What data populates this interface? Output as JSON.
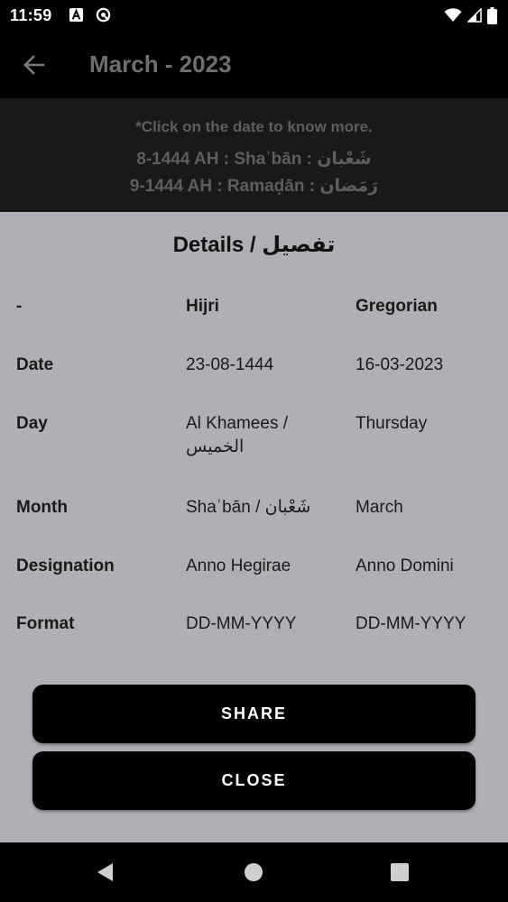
{
  "status_bar": {
    "time": "11:59",
    "left_icons": [
      "a-notification-icon",
      "sync-circle-icon"
    ],
    "right_icons": [
      "wifi-icon",
      "signal-icon",
      "battery-icon"
    ]
  },
  "app_bar": {
    "title": "March - 2023",
    "back_icon": "arrow-left-icon"
  },
  "info_panel": {
    "hint": "*Click on the date to know more.",
    "lines": [
      "8-1444 AH : Shaʿbān : شَعْبان",
      "9-1444 AH : Ramaḍān : رَمَضان"
    ]
  },
  "details": {
    "title": "Details / تفصيل",
    "rows": [
      {
        "label": "-",
        "hijri": "Hijri",
        "gregorian": "Gregorian",
        "header": true
      },
      {
        "label": "Date",
        "hijri": "23-08-1444",
        "gregorian": "16-03-2023"
      },
      {
        "label": "Day",
        "hijri": "Al Khamees / الخميس",
        "gregorian": "Thursday"
      },
      {
        "label": "Month",
        "hijri": "Shaʿbān / شَعْبان",
        "gregorian": "March"
      },
      {
        "label": "Designation",
        "hijri": "Anno Hegirae",
        "gregorian": "Anno Domini"
      },
      {
        "label": "Format",
        "hijri": "DD-MM-YYYY",
        "gregorian": "DD-MM-YYYY"
      }
    ],
    "share_label": "SHARE",
    "close_label": "CLOSE"
  },
  "nav_bar": {
    "icons": [
      "back-triangle-icon",
      "home-circle-icon",
      "recents-square-icon"
    ]
  },
  "colors": {
    "sheet_background": "#b1afb5",
    "button_background": "#000000",
    "info_panel_background": "#191919"
  }
}
